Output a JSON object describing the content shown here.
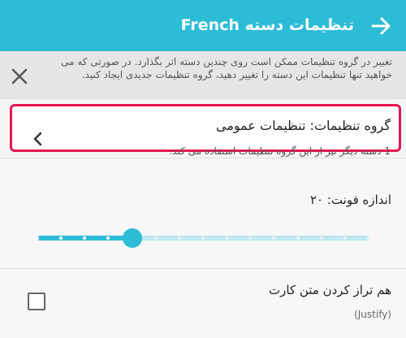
{
  "header": {
    "title": "تنظیمات دسته French",
    "back_icon": "arrow-right-icon"
  },
  "notice": {
    "text": "تغییر در گروه تنظیمات ممکن است روی چندین دسته اثر بگذارد. در صورتی که می خواهید تنها تنظیمات این دسته را تغییر دهید، گروه تنظیمات جدیدی ایجاد کنید.",
    "close_icon": "close-icon"
  },
  "group": {
    "title": "گروه تنظیمات: تنظیمات عمومی",
    "subtitle": "1 دسته دیگر نیز از این گروه تنظیمات استفاده می کند.",
    "chevron_icon": "chevron-left-icon"
  },
  "font_size": {
    "label": "اندازه فونت: ۲۰",
    "slider": {
      "min": 0,
      "max": 14,
      "value": 4,
      "step_count": 14
    }
  },
  "justify": {
    "label": "هم تراز کردن متن کارت",
    "sublabel": "(Justify)",
    "checked": false
  },
  "colors": {
    "accent": "#2dbcd6",
    "highlight_border": "#e3174f"
  }
}
